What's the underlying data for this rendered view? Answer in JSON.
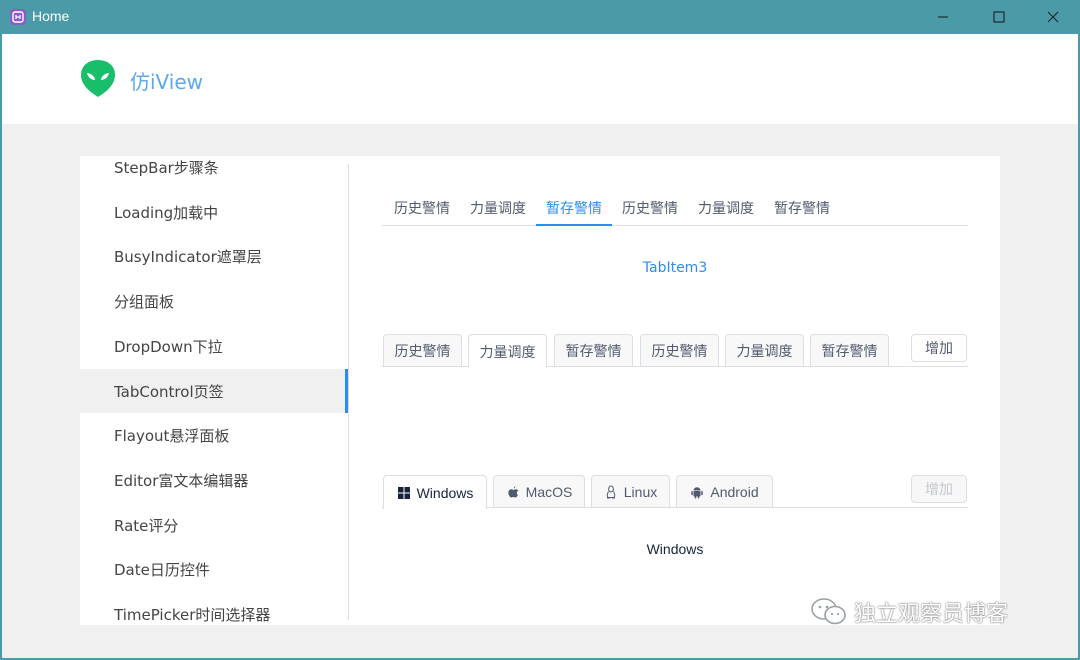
{
  "window": {
    "title": "Home",
    "minimize_glyph": "—",
    "maximize_glyph": "☐",
    "close_glyph": "✕"
  },
  "header": {
    "brand": "仿iView"
  },
  "sidebar": {
    "items": [
      {
        "label": "StepBar步骤条"
      },
      {
        "label": "Loading加载中"
      },
      {
        "label": "BusyIndicator遮罩层"
      },
      {
        "label": "分组面板"
      },
      {
        "label": "DropDown下拉"
      },
      {
        "label": "TabControl页签"
      },
      {
        "label": "Flayout悬浮面板"
      },
      {
        "label": "Editor富文本编辑器"
      },
      {
        "label": "Rate评分"
      },
      {
        "label": "Date日历控件"
      },
      {
        "label": "TimePicker时间选择器"
      }
    ],
    "active_index": 5
  },
  "tabs1": {
    "items": [
      {
        "label": "历史警情"
      },
      {
        "label": "力量调度"
      },
      {
        "label": "暂存警情"
      },
      {
        "label": "历史警情"
      },
      {
        "label": "力量调度"
      },
      {
        "label": "暂存警情"
      }
    ],
    "active_index": 2,
    "content": "TabItem3"
  },
  "tabs2": {
    "items": [
      {
        "label": "历史警情"
      },
      {
        "label": "力量调度"
      },
      {
        "label": "暂存警情"
      },
      {
        "label": "历史警情"
      },
      {
        "label": "力量调度"
      },
      {
        "label": "暂存警情"
      }
    ],
    "active_index": 1,
    "add_label": "增加"
  },
  "tabs3": {
    "items": [
      {
        "label": "Windows",
        "icon": "windows-icon"
      },
      {
        "label": "MacOS",
        "icon": "apple-icon"
      },
      {
        "label": "Linux",
        "icon": "linux-icon"
      },
      {
        "label": "Android",
        "icon": "android-icon"
      }
    ],
    "active_index": 0,
    "add_label": "增加",
    "content": "Windows"
  },
  "watermark": {
    "text": "独立观察员博客"
  },
  "colors": {
    "titlebar": "#4a9aa8",
    "accent": "#2d8cf0",
    "brand": "#5aa9ef",
    "logo": "#19be6b"
  }
}
